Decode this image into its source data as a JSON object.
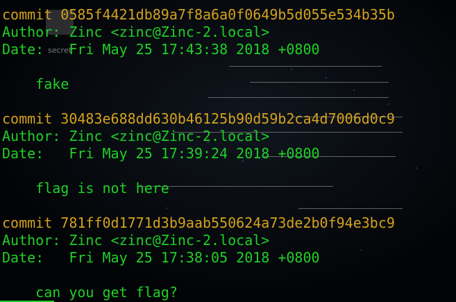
{
  "terminal": {
    "lines": [
      {
        "text": "commit 0585f4421db89a7f8a6a0f0649b5d055e534b35b",
        "kind": "commit"
      },
      {
        "text": "Author: Zinc <zinc@Zinc-2.local>",
        "kind": "meta"
      },
      {
        "text": "Date:   Fri May 25 17:43:38 2018 +0800",
        "kind": "meta"
      },
      {
        "text": "",
        "kind": "blank"
      },
      {
        "text": "    fake",
        "kind": "message"
      },
      {
        "text": "",
        "kind": "blank"
      },
      {
        "text": "commit 30483e688dd630b46125b90d59b2ca4d7006d0c9",
        "kind": "commit"
      },
      {
        "text": "Author: Zinc <zinc@Zinc-2.local>",
        "kind": "meta"
      },
      {
        "text": "Date:   Fri May 25 17:39:24 2018 +0800",
        "kind": "meta"
      },
      {
        "text": "",
        "kind": "blank"
      },
      {
        "text": "    flag is not here",
        "kind": "message"
      },
      {
        "text": "",
        "kind": "blank"
      },
      {
        "text": "commit 781ff0d1771d3b9aab550624a73de2b0f94e3bc9",
        "kind": "commit"
      },
      {
        "text": "Author: Zinc <zinc@Zinc-2.local>",
        "kind": "meta"
      },
      {
        "text": "Date:   Fri May 25 17:38:05 2018 +0800",
        "kind": "meta"
      },
      {
        "text": "",
        "kind": "blank"
      },
      {
        "text": "    can you get flag?",
        "kind": "message"
      }
    ],
    "ghost_label": "secret"
  },
  "colors": {
    "commit": "#d4a21e",
    "text": "#1fd126",
    "background": "#020306"
  }
}
